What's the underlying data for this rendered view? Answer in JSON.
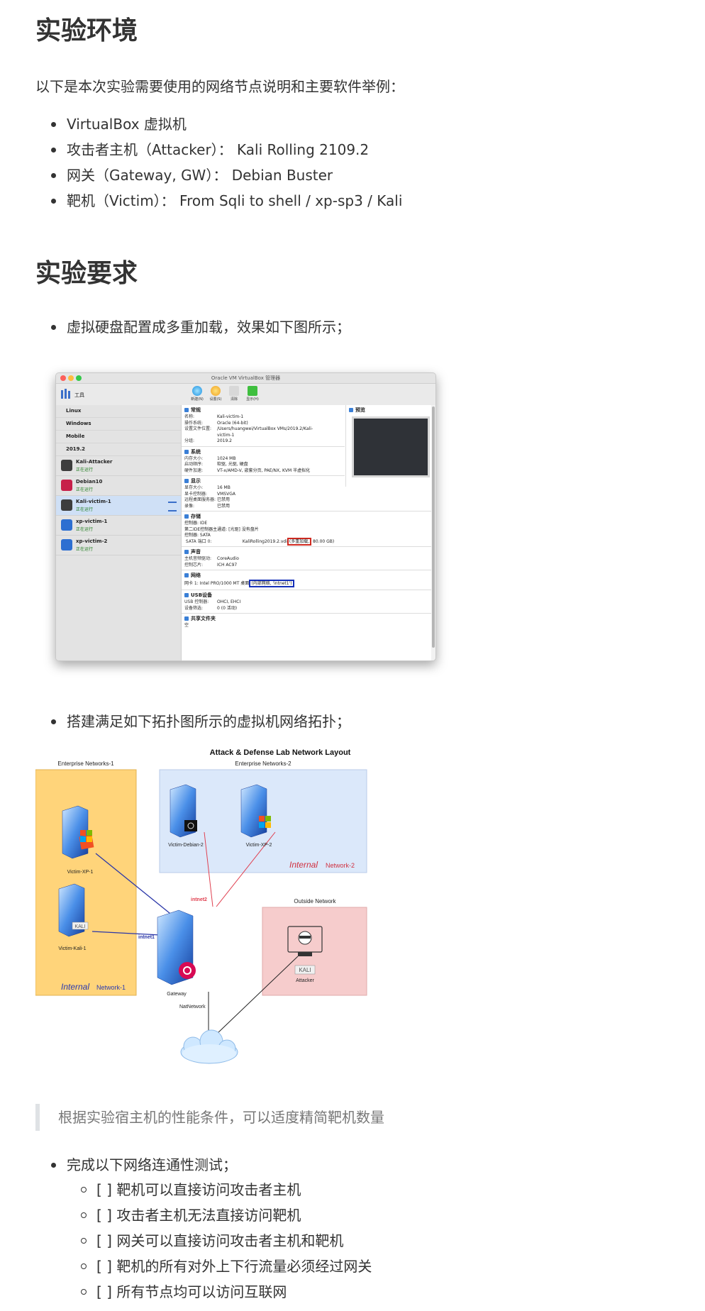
{
  "sections": [
    {
      "title": "实验环境"
    },
    {
      "title": "实验要求"
    }
  ],
  "intro": "以下是本次实验需要使用的网络节点说明和主要软件举例：",
  "env_items": [
    "VirtualBox 虚拟机",
    "攻击者主机（Attacker）： Kali Rolling 2109.2",
    "网关（Gateway, GW）： Debian Buster",
    "靶机（Victim）： From Sqli to shell / xp-sp3 / Kali"
  ],
  "req_item_1": "虚拟硬盘配置成多重加载，效果如下图所示；",
  "req_item_2": "搭建满足如下拓扑图所示的虚拟机网络拓扑；",
  "blockquote": "根据实验宿主机的性能条件，可以适度精简靶机数量",
  "req_item_3": "完成以下网络连通性测试；",
  "checklist": [
    "[ ] 靶机可以直接访问攻击者主机",
    "[ ] 攻击者主机无法直接访问靶机",
    "[ ] 网关可以直接访问攻击者主机和靶机",
    "[ ] 靶机的所有对外上下行流量必须经过网关",
    "[ ] 所有节点均可以访问互联网"
  ],
  "vbox": {
    "window_title": "Oracle VM VirtualBox 管理器",
    "tools_label": "工具",
    "toolbar": [
      "新建(N)",
      "设置(S)",
      "清除",
      "显示(H)"
    ],
    "groups": [
      "Linux",
      "Windows",
      "Mobile",
      "2019.2"
    ],
    "vms": [
      {
        "name": "Kali-Attacker",
        "status": "正在运行"
      },
      {
        "name": "Debian10",
        "status": "正在运行"
      },
      {
        "name": "Kali-victim-1",
        "status": "正在运行"
      },
      {
        "name": "xp-victim-1",
        "status": "正在运行"
      },
      {
        "name": "xp-victim-2",
        "status": "正在运行"
      }
    ],
    "general": {
      "header": "常规",
      "rows": [
        [
          "名称:",
          "Kali-victim-1"
        ],
        [
          "操作系统:",
          "Oracle (64-bit)"
        ],
        [
          "设置文件位置:",
          "/Users/huangwei/VirtualBox VMs/2019.2/Kali-"
        ],
        [
          "",
          "victim-1"
        ],
        [
          "分组:",
          "2019.2"
        ]
      ]
    },
    "preview_header": "预览",
    "system": {
      "header": "系统",
      "rows": [
        [
          "内存大小:",
          "1024 MB"
        ],
        [
          "启动顺序:",
          "软驱, 光驱, 硬盘"
        ],
        [
          "硬件加速:",
          "VT-x/AMD-V, 嵌套分页, PAE/NX, KVM 半虚拟化"
        ]
      ]
    },
    "display": {
      "header": "显示",
      "rows": [
        [
          "显存大小:",
          "16 MB"
        ],
        [
          "显卡控制器:",
          "VMSVGA"
        ],
        [
          "远程桌面服务器:",
          "已禁用"
        ],
        [
          "录像:",
          "已禁用"
        ]
      ]
    },
    "storage": {
      "header": "存储",
      "rows": [
        [
          "控制器: IDE",
          ""
        ],
        [
          "  第二IDE控制器主通道:",
          "[光驱] 没有盘片"
        ],
        [
          "控制器: SATA",
          ""
        ]
      ],
      "sata_label": "SATA 端口 0:",
      "sata_file": "KaliRolling2019.2.vdi",
      "sata_mode": "(多重加载,",
      "sata_size": "80.00 GB)"
    },
    "audio": {
      "header": "声音",
      "rows": [
        [
          "主机音频驱动:",
          "CoreAudio"
        ],
        [
          "控制芯片:",
          "ICH AC97"
        ]
      ]
    },
    "network": {
      "header": "网络",
      "nic": "网卡 1:  Intel PRO/1000 MT 桌面",
      "mode": "(内部网络, 'intnet1')"
    },
    "usb": {
      "header": "USB设备",
      "rows": [
        [
          "USB 控制器:",
          "OHCI, EHCI"
        ],
        [
          "设备筛选:",
          "0 (0 活动)"
        ]
      ]
    },
    "shared": {
      "header": "共享文件夹",
      "value": "空"
    }
  },
  "topology": {
    "title": "Attack & Defense Lab Network Layout",
    "zone1_label": "Enterprise Networks-1",
    "zone2_label": "Enterprise Networks-2",
    "zone3_label": "Outside Network",
    "net1_word": "Internal",
    "net1_rest": "Network-1",
    "net2_word": "Internal",
    "net2_rest": "Network-2",
    "victim_xp1": "Victim-XP-1",
    "victim_kali1": "Victim-Kali-1",
    "victim_debian2": "Victim-Debian-2",
    "victim_xp2": "Victim-XP-2",
    "gateway": "Gateway",
    "attacker": "Attacker",
    "kali_badge": "KALI",
    "intnet1": "intnet1",
    "intnet2": "intnet2",
    "natnetwork": "NatNetwork",
    "colors": {
      "zone1": "#ffd47a",
      "zone2": "#dbe8fa",
      "zone3": "#f6cccc",
      "line_blue": "#2a36a8",
      "line_red": "#e04050",
      "line_black": "#222222"
    }
  }
}
